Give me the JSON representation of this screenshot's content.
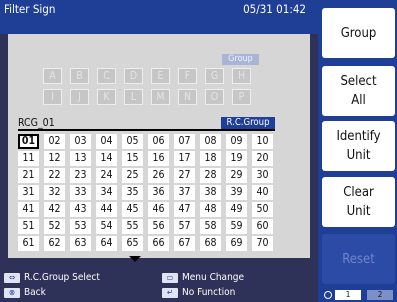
{
  "header": {
    "title": "Filter Sign",
    "datetime": "05/31 01:42"
  },
  "groups": {
    "label": "Group",
    "row1": [
      "A",
      "B",
      "C",
      "D",
      "E",
      "F",
      "G",
      "H"
    ],
    "row2": [
      "I",
      "J",
      "K",
      "L",
      "M",
      "N",
      "O",
      "P"
    ]
  },
  "rc_group": {
    "name": "RCG_01",
    "badge": "R.C.Group",
    "numbers": [
      [
        "01",
        "02",
        "03",
        "04",
        "05",
        "06",
        "07",
        "08",
        "09",
        "10"
      ],
      [
        "11",
        "12",
        "13",
        "14",
        "15",
        "16",
        "17",
        "18",
        "19",
        "20"
      ],
      [
        "21",
        "22",
        "23",
        "24",
        "25",
        "26",
        "27",
        "28",
        "29",
        "30"
      ],
      [
        "31",
        "32",
        "33",
        "34",
        "35",
        "36",
        "37",
        "38",
        "39",
        "40"
      ],
      [
        "41",
        "42",
        "43",
        "44",
        "45",
        "46",
        "47",
        "48",
        "49",
        "50"
      ],
      [
        "51",
        "52",
        "53",
        "54",
        "55",
        "56",
        "57",
        "58",
        "59",
        "60"
      ],
      [
        "61",
        "62",
        "63",
        "64",
        "65",
        "66",
        "67",
        "68",
        "69",
        "70"
      ]
    ],
    "selected": "01"
  },
  "footer": {
    "rc_group_select": "R.C.Group Select",
    "back": "Back",
    "menu_change": "Menu Change",
    "no_function": "No Function"
  },
  "buttons": {
    "group": "Group",
    "select_all_1": "Select",
    "select_all_2": "All",
    "identify_1": "Identify",
    "identify_2": "Unit",
    "clear_1": "Clear",
    "clear_2": "Unit",
    "reset": "Reset"
  },
  "pager": {
    "p1": "1",
    "p2": "2"
  }
}
